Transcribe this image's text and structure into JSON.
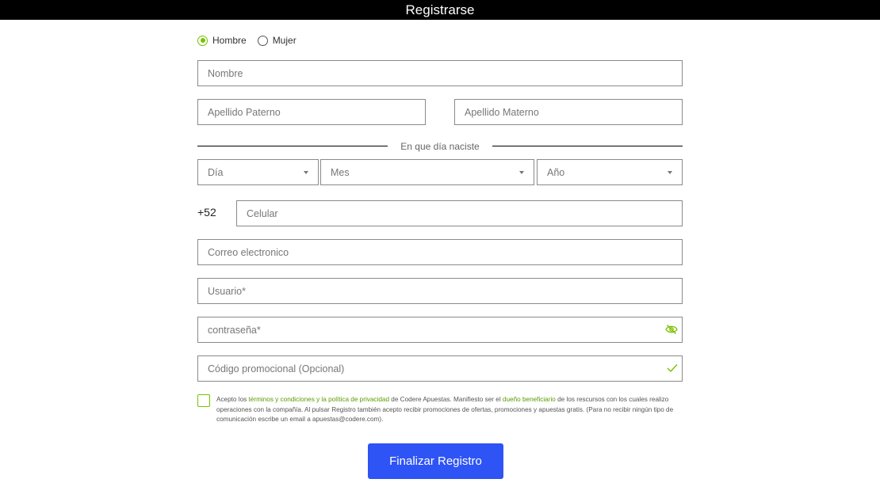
{
  "header": {
    "title": "Registrarse"
  },
  "gender": {
    "options": [
      "Hombre",
      "Mujer"
    ],
    "selected": "Hombre"
  },
  "fields": {
    "nombre": {
      "placeholder": "Nombre",
      "value": ""
    },
    "apellido_paterno": {
      "placeholder": "Apellido Paterno",
      "value": ""
    },
    "apellido_materno": {
      "placeholder": "Apellido Materno",
      "value": ""
    },
    "celular": {
      "placeholder": "Celular",
      "value": ""
    },
    "correo": {
      "placeholder": "Correo electronico",
      "value": ""
    },
    "usuario": {
      "placeholder": "Usuario*",
      "value": ""
    },
    "contrasena": {
      "placeholder": "contraseña*",
      "value": ""
    },
    "codigo_promocional": {
      "placeholder": "Código promocional (Opcional)",
      "value": ""
    }
  },
  "birthdate": {
    "label": "En que día naciste",
    "day": "Día",
    "month": "Mes",
    "year": "Año"
  },
  "phone": {
    "prefix": "+52"
  },
  "terms": {
    "checked": false,
    "part1": "Acepto los ",
    "link1": "términos y condiciones y la política de privacidad",
    "part2": " de Codere Apuestas. Manifiesto ser el ",
    "link2": "dueño beneficiario",
    "part3": " de los rescursos con los cuales realizo operaciones con la compañía. Al pulsar Registro también acepto recibir promociones de ofertas, promociones y apuestas gratis. (Para no recibir ningún tipo de comunicación escribe un email a apuestas@codere.com)."
  },
  "submit": {
    "label": "Finalizar Registro"
  },
  "icons": {
    "password_toggle": "eye-off-icon",
    "promo_valid": "check-icon"
  },
  "colors": {
    "accent": "#79c000",
    "button": "#2e54f5",
    "header_bg": "#000000"
  }
}
